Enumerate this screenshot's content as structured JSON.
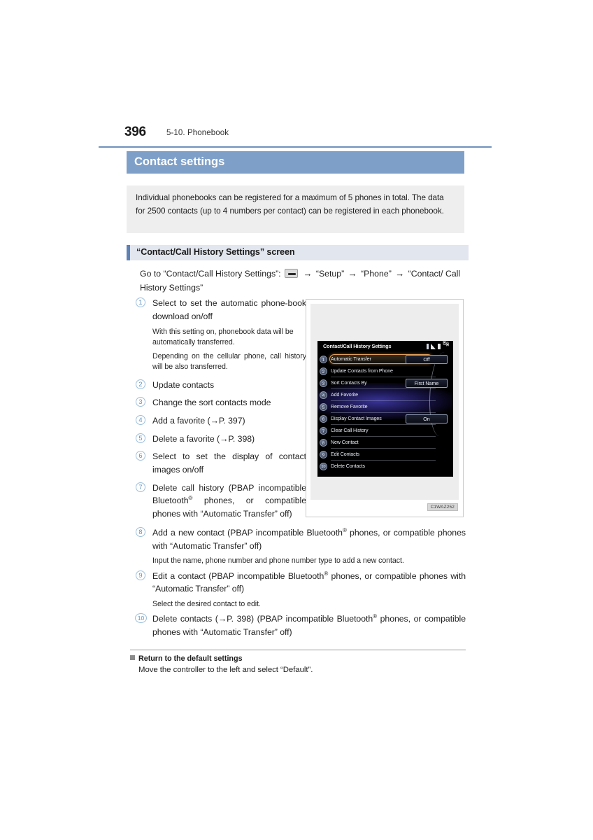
{
  "header": {
    "page_number": "396",
    "section": "5-10. Phonebook"
  },
  "title_bar": {
    "label": "Contact settings"
  },
  "intro": {
    "text": "Individual phonebooks can be registered for a maximum of 5 phones in total. The data for 2500 contacts (up to 4 numbers per contact) can be registered in each phonebook."
  },
  "subheading": {
    "label": "“Contact/Call History Settings” screen"
  },
  "goto": {
    "prefix": "Go to “Contact/Call History Settings”:",
    "arrow": "→",
    "step1": "“Setup”",
    "step2": "“Phone”",
    "step3": "“Contact/ Call History Settings”",
    "icon": "menu-button-icon"
  },
  "items": [
    {
      "num": "1",
      "text": "Select to set the automatic phone-book download on/off",
      "subs": [
        "With this setting on, phonebook data will be automatically transferred.",
        "Depending on the cellular phone, call history will be also transferred."
      ]
    },
    {
      "num": "2",
      "text": "Update contacts",
      "subs": []
    },
    {
      "num": "3",
      "text": "Change the sort contacts mode",
      "subs": []
    },
    {
      "num": "4",
      "text": "Add a favorite (→P. 397)",
      "subs": []
    },
    {
      "num": "5",
      "text": "Delete a favorite (→P. 398)",
      "subs": []
    },
    {
      "num": "6",
      "text": "Select to set the display of contact images on/off",
      "subs": []
    },
    {
      "num": "7",
      "text": "Delete call history (PBAP incompatible Bluetooth® phones, or compatible phones with “Automatic Transfer” off)",
      "subs": []
    }
  ],
  "items_wide": [
    {
      "num": "8",
      "text_pre": "Add a new contact (PBAP incompatible Bluetooth",
      "text_post": " phones, or compatible phones with “Automatic Transfer” off)",
      "subs": [
        "Input the name, phone number and phone number type to add a new contact."
      ]
    },
    {
      "num": "9",
      "text_pre": "Edit a contact (PBAP incompatible Bluetooth",
      "text_post": " phones, or compatible phones with “Automatic Transfer” off)",
      "subs": [
        "Select the desired contact to edit."
      ]
    },
    {
      "num": "10",
      "text_pre": "Delete contacts (→P. 398) (PBAP incompatible Bluetooth",
      "text_post": " phones, or compatible phones with “Automatic Transfer” off)",
      "subs": []
    }
  ],
  "registered_mark": "®",
  "figure": {
    "code": "C1WAZ252",
    "screen": {
      "title": "Contact/Call History Settings",
      "status_icons": [
        "bluetooth-icon",
        "signal-icon",
        "battery-icon",
        "back-icon"
      ],
      "rows": [
        {
          "num": "1",
          "label": "Automatic Transfer",
          "value": "Off",
          "selected": true
        },
        {
          "num": "2",
          "label": "Update Contacts from Phone",
          "value": "",
          "selected": false
        },
        {
          "num": "3",
          "label": "Sort Contacts By",
          "value": "First Name",
          "selected": false
        },
        {
          "num": "4",
          "label": "Add Favorite",
          "value": "",
          "selected": false
        },
        {
          "num": "5",
          "label": "Remove Favorite",
          "value": "",
          "selected": false
        },
        {
          "num": "6",
          "label": "Display Contact Images",
          "value": "On",
          "selected": false
        },
        {
          "num": "7",
          "label": "Clear Call History",
          "value": "",
          "selected": false
        },
        {
          "num": "8",
          "label": "New Contact",
          "value": "",
          "selected": false
        },
        {
          "num": "9",
          "label": "Edit Contacts",
          "value": "",
          "selected": false
        },
        {
          "num": "10",
          "label": "Delete Contacts",
          "value": "",
          "selected": false
        }
      ]
    }
  },
  "return_block": {
    "heading": "Return to the default settings",
    "body": "Move the controller to the left and select “Default”."
  },
  "colors": {
    "title_bar": "#7e9fc8",
    "rule": "#6f92bd",
    "subhead_bg": "#e2e6ee",
    "subhead_tick": "#5e82b4",
    "intro_bg": "#eeeeee",
    "circle_num": "#5f93c0",
    "highlight": "#e3a15c"
  }
}
